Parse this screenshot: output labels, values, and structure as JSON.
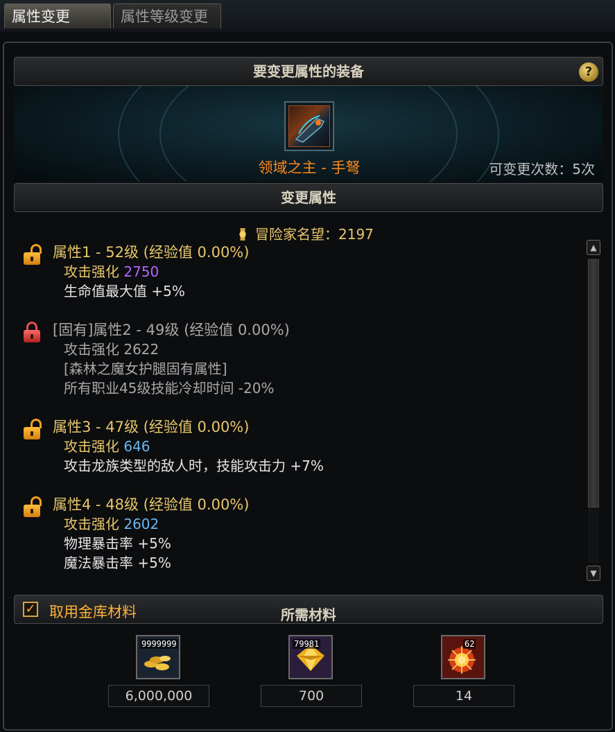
{
  "tabs": [
    {
      "label": "属性变更"
    },
    {
      "label": "属性等级变更"
    }
  ],
  "equip_section": {
    "title": "要变更属性的装备",
    "help_glyph": "?",
    "item_name": "领域之主 - 手弩",
    "change_count": "可变更次数：5次"
  },
  "attr_section": {
    "title": "变更属性",
    "fame_label": "冒险家名望：2197",
    "attributes": [
      {
        "title": "属性1 - 52级 (经验值 0.00%)",
        "lock": "unlocked",
        "line1_label": "攻击强化",
        "line1_value": "2750",
        "lines": [
          "生命值最大值 +5%"
        ]
      },
      {
        "title": "[固有]属性2 - 49级 (经验值 0.00%)",
        "lock": "locked",
        "line1_label": "攻击强化",
        "line1_value": "2622",
        "lines": [
          "[森林之魔女护腿固有属性]",
          "所有职业45级技能冷却时间 -20%"
        ]
      },
      {
        "title": "属性3 - 47级 (经验值 0.00%)",
        "lock": "unlocked",
        "line1_label": "攻击强化",
        "line1_value": "646",
        "lines": [
          "攻击龙族类型的敌人时，技能攻击力 +7%"
        ]
      },
      {
        "title": "属性4 - 48级 (经验值 0.00%)",
        "lock": "unlocked",
        "line1_label": "攻击强化",
        "line1_value": "2602",
        "lines": [
          "物理暴击率 +5%",
          "魔法暴击率 +5%"
        ]
      }
    ],
    "colors": {
      "gold": "#e8c66a",
      "purple": "#b266ff",
      "cyan": "#6ab6f0"
    }
  },
  "materials": {
    "use_vault_label": "取用金库材料",
    "use_vault_checked": true,
    "title": "所需材料",
    "items": [
      {
        "icon": "gold-coins-icon",
        "stock": "9999999",
        "required": "6,000,000"
      },
      {
        "icon": "yellow-crystal-icon",
        "stock": "79981",
        "required": "700"
      },
      {
        "icon": "burst-orb-icon",
        "stock": "62",
        "required": "14"
      }
    ]
  }
}
